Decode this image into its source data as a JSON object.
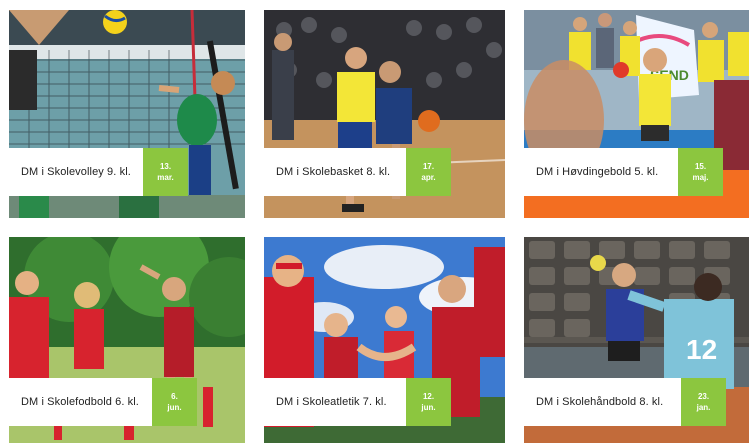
{
  "colors": {
    "accent_green": "#8cc63f",
    "label_bg": "#ffffff",
    "label_text": "#222222"
  },
  "events": [
    {
      "title": "DM i Skolevolley 9. kl.",
      "date_day": "13.",
      "date_month": "mar."
    },
    {
      "title": "DM i Skolebasket 8. kl.",
      "date_day": "17.",
      "date_month": "apr."
    },
    {
      "title": "DM i Høvdingebold 5. kl.",
      "date_day": "15.",
      "date_month": "maj."
    },
    {
      "title": "DM i Skolefodbold 6. kl.",
      "date_day": "6.",
      "date_month": "jun."
    },
    {
      "title": "DM i Skoleatletik 7. kl.",
      "date_day": "12.",
      "date_month": "jun."
    },
    {
      "title": "DM i Skolehåndbold 8. kl.",
      "date_day": "23.",
      "date_month": "jan."
    }
  ],
  "photo_text": {
    "jersey_number": "12",
    "banner_text": "SEND"
  }
}
